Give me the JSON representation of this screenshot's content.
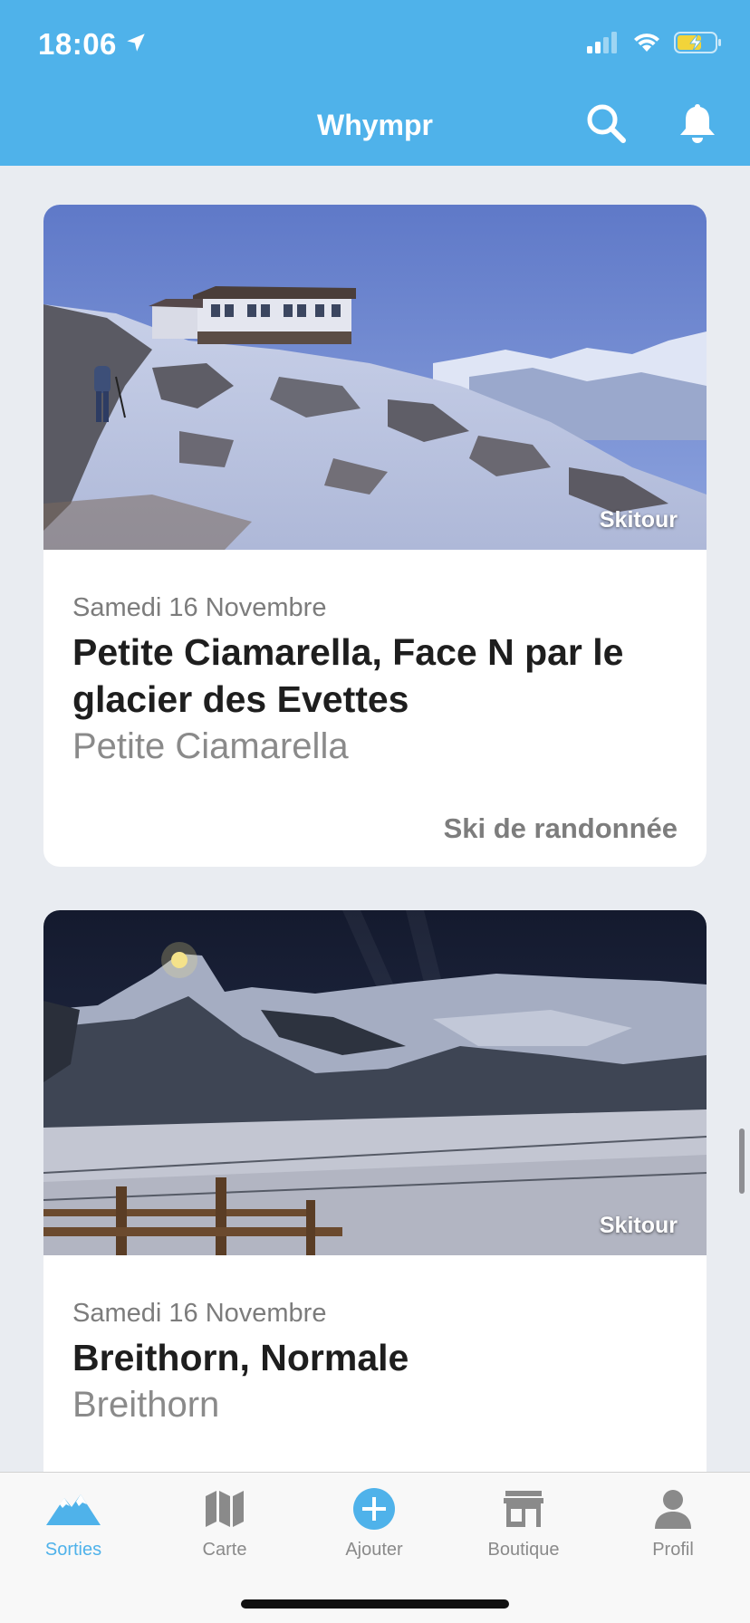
{
  "status_bar": {
    "time": "18:06"
  },
  "header": {
    "title": "Whympr"
  },
  "colors": {
    "brand": "#4fb2ea",
    "background": "#e9ecf1"
  },
  "feed": [
    {
      "tag": "Skitour",
      "date": "Samedi 16 Novembre",
      "title": "Petite Ciamarella, Face N par le glacier des Evettes",
      "summit": "Petite Ciamarella",
      "activity": "Ski de randonnée"
    },
    {
      "tag": "Skitour",
      "date": "Samedi 16 Novembre",
      "title": "Breithorn, Normale",
      "summit": "Breithorn",
      "activity": ""
    }
  ],
  "tabbar": [
    {
      "label": "Sorties",
      "icon": "mountain-icon",
      "active": true
    },
    {
      "label": "Carte",
      "icon": "map-icon",
      "active": false
    },
    {
      "label": "Ajouter",
      "icon": "add-circle-icon",
      "active": false
    },
    {
      "label": "Boutique",
      "icon": "shop-icon",
      "active": false
    },
    {
      "label": "Profil",
      "icon": "person-icon",
      "active": false
    }
  ]
}
